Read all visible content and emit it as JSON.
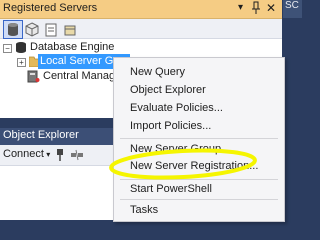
{
  "registered_servers": {
    "title": "Registered Servers",
    "title_controls": {
      "dropdown": "▾",
      "close": "✕"
    },
    "tree": {
      "root": "Database Engine",
      "group": "Local Server G",
      "central": "Central Manag"
    }
  },
  "right_panel": {
    "tab_label": "SC"
  },
  "object_explorer": {
    "title": "Object Explorer",
    "connect_label": "Connect"
  },
  "context_menu": {
    "items": [
      "New Query",
      "Object Explorer",
      "Evaluate Policies...",
      "Import Policies...",
      "New Server Group...",
      "New Server Registration...",
      "Start PowerShell",
      "Tasks"
    ]
  },
  "colors": {
    "rs_title_bg": "#f5cc84",
    "selection": "#3399ff",
    "dark_chrome": "#2b3c5f",
    "highlight": "#f5f500"
  }
}
